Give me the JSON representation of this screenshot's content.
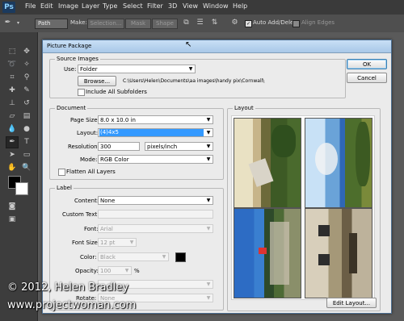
{
  "app": {
    "logo": "Ps"
  },
  "menubar": [
    "File",
    "Edit",
    "Image",
    "Layer",
    "Type",
    "Select",
    "Filter",
    "3D",
    "View",
    "Window",
    "Help"
  ],
  "options_bar": {
    "tool_mode": "Path",
    "make_label": "Make:",
    "selection_btn": "Selection...",
    "mask_btn": "Mask",
    "shape_btn": "Shape",
    "auto_add_delete_label": "Auto Add/Delete",
    "align_edges_label": "Align Edges"
  },
  "dialog": {
    "title": "Picture Package",
    "source_images": {
      "legend": "Source Images",
      "use_label": "Use:",
      "use_value": "Folder",
      "browse_label": "Browse...",
      "folder_path": "C:\\Users\\Helen\\Documents\\aa images\\handy pix\\Cornwall\\",
      "include_subfolders_label": "Include All Subfolders"
    },
    "document": {
      "legend": "Document",
      "page_size_label": "Page Size:",
      "page_size_value": "8.0 x 10.0 in",
      "layout_label": "Layout:",
      "layout_value": "(4)4x5",
      "resolution_label": "Resolution:",
      "resolution_value": "300",
      "resolution_unit": "pixels/inch",
      "mode_label": "Mode:",
      "mode_value": "RGB Color",
      "flatten_label": "Flatten All Layers"
    },
    "label": {
      "legend": "Label",
      "content_label": "Content:",
      "content_value": "None",
      "custom_text_label": "Custom Text:",
      "custom_text_value": "",
      "font_label": "Font:",
      "font_value": "Arial",
      "font_size_label": "Font Size:",
      "font_size_value": "12 pt",
      "color_label": "Color:",
      "color_value": "Black",
      "opacity_label": "Opacity:",
      "opacity_value": "100",
      "opacity_unit": "%",
      "position_value": "",
      "rotate_label": "Rotate:",
      "rotate_value": "None"
    },
    "layout_panel": {
      "legend": "Layout",
      "edit_layout_label": "Edit Layout..."
    },
    "ok_label": "OK",
    "cancel_label": "Cancel"
  },
  "watermark": {
    "line1": "© 2012, Helen Bradley",
    "line2": "www.projectwoman.com"
  },
  "colors": {
    "accent": "#3399ff",
    "ps_chrome": "#3d3d3d",
    "swatch_black": "#000000"
  }
}
